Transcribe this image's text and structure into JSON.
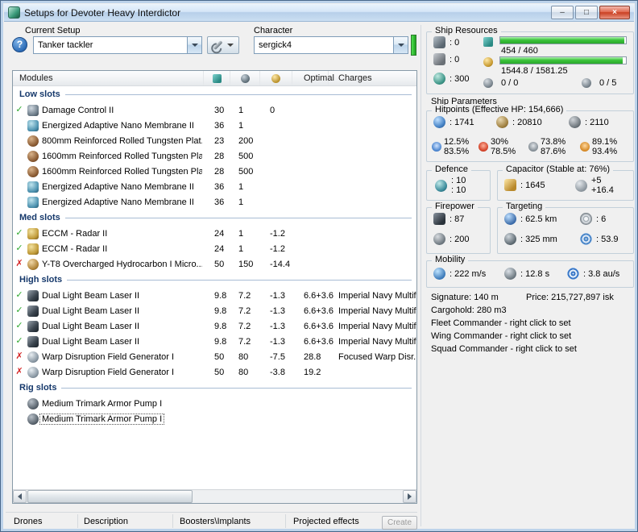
{
  "window": {
    "title": "Setups for Devoter Heavy Interdictor",
    "controls": {
      "minimize": "–",
      "maximize": "□",
      "close": "×"
    }
  },
  "status_glyphs": {
    "ok": "✓",
    "error": "✗"
  },
  "toolbar": {
    "help_label": "?",
    "current_setup_label": "Current Setup",
    "current_setup_value": "Tanker tackler",
    "character_label": "Character",
    "character_value": "sergick4"
  },
  "ship_resources": {
    "title": "Ship Resources",
    "turret_hardpoints": ": 0",
    "launcher_hardpoints": ": 0",
    "calibration": ": 300",
    "cpu": {
      "text": "454 / 460",
      "pct": 98.7
    },
    "powergrid": {
      "text": "1544.8 / 1581.25",
      "pct": 97.7
    },
    "drones": {
      "left": "0 / 0",
      "right": "0 / 5"
    }
  },
  "table": {
    "columns": {
      "modules": "Modules",
      "optimal": "Optimal",
      "charges": "Charges"
    },
    "sections": [
      {
        "name": "Low slots",
        "rows": [
          {
            "status": "ok",
            "icon": "damage-control",
            "name": "Damage Control II",
            "cpu": "30",
            "pg": "1",
            "cap": "0",
            "optimal": "",
            "charges": ""
          },
          {
            "status": "",
            "icon": "membrane",
            "name": "Energized Adaptive Nano Membrane II",
            "cpu": "36",
            "pg": "1",
            "cap": "",
            "optimal": "",
            "charges": ""
          },
          {
            "status": "",
            "icon": "plate",
            "name": "800mm Reinforced Rolled Tungsten Plat...",
            "cpu": "23",
            "pg": "200",
            "cap": "",
            "optimal": "",
            "charges": ""
          },
          {
            "status": "",
            "icon": "plate",
            "name": "1600mm Reinforced Rolled Tungsten Pla...",
            "cpu": "28",
            "pg": "500",
            "cap": "",
            "optimal": "",
            "charges": ""
          },
          {
            "status": "",
            "icon": "plate",
            "name": "1600mm Reinforced Rolled Tungsten Pla...",
            "cpu": "28",
            "pg": "500",
            "cap": "",
            "optimal": "",
            "charges": ""
          },
          {
            "status": "",
            "icon": "membrane",
            "name": "Energized Adaptive Nano Membrane II",
            "cpu": "36",
            "pg": "1",
            "cap": "",
            "optimal": "",
            "charges": ""
          },
          {
            "status": "",
            "icon": "membrane",
            "name": "Energized Adaptive Nano Membrane II",
            "cpu": "36",
            "pg": "1",
            "cap": "",
            "optimal": "",
            "charges": ""
          }
        ]
      },
      {
        "name": "Med slots",
        "rows": [
          {
            "status": "ok",
            "icon": "eccm",
            "name": "ECCM - Radar II",
            "cpu": "24",
            "pg": "1",
            "cap": "-1.2",
            "optimal": "",
            "charges": ""
          },
          {
            "status": "ok",
            "icon": "eccm",
            "name": "ECCM - Radar II",
            "cpu": "24",
            "pg": "1",
            "cap": "-1.2",
            "optimal": "",
            "charges": ""
          },
          {
            "status": "error",
            "icon": "mwd",
            "name": "Y-T8 Overcharged Hydrocarbon I Micro...",
            "cpu": "50",
            "pg": "150",
            "cap": "-14.4",
            "optimal": "",
            "charges": ""
          }
        ]
      },
      {
        "name": "High slots",
        "rows": [
          {
            "status": "ok",
            "icon": "laser",
            "name": "Dual Light Beam Laser II",
            "cpu": "9.8",
            "pg": "7.2",
            "cap": "-1.3",
            "optimal": "6.6+3.6",
            "charges": "Imperial Navy Multif..."
          },
          {
            "status": "ok",
            "icon": "laser",
            "name": "Dual Light Beam Laser II",
            "cpu": "9.8",
            "pg": "7.2",
            "cap": "-1.3",
            "optimal": "6.6+3.6",
            "charges": "Imperial Navy Multif..."
          },
          {
            "status": "ok",
            "icon": "laser",
            "name": "Dual Light Beam Laser II",
            "cpu": "9.8",
            "pg": "7.2",
            "cap": "-1.3",
            "optimal": "6.6+3.6",
            "charges": "Imperial Navy Multif..."
          },
          {
            "status": "ok",
            "icon": "laser",
            "name": "Dual Light Beam Laser II",
            "cpu": "9.8",
            "pg": "7.2",
            "cap": "-1.3",
            "optimal": "6.6+3.6",
            "charges": "Imperial Navy Multif..."
          },
          {
            "status": "error",
            "icon": "fieldgen",
            "name": "Warp Disruption Field Generator I",
            "cpu": "50",
            "pg": "80",
            "cap": "-7.5",
            "optimal": "28.8",
            "charges": "Focused Warp Disr..."
          },
          {
            "status": "error",
            "icon": "fieldgen",
            "name": "Warp Disruption Field Generator I",
            "cpu": "50",
            "pg": "80",
            "cap": "-3.8",
            "optimal": "19.2",
            "charges": ""
          }
        ]
      },
      {
        "name": "Rig slots",
        "rows": [
          {
            "status": "",
            "icon": "rig",
            "name": "Medium Trimark Armor Pump I",
            "cpu": "",
            "pg": "",
            "cap": "",
            "optimal": "",
            "charges": ""
          },
          {
            "status": "",
            "icon": "rig",
            "name": "Medium Trimark Armor Pump I",
            "cpu": "",
            "pg": "",
            "cap": "",
            "optimal": "",
            "charges": "",
            "selected": true
          }
        ]
      }
    ]
  },
  "ship_parameters": {
    "title": "Ship Parameters",
    "hitpoints": {
      "title": "Hitpoints (Effective HP: 154,666)",
      "shield": ": 1741",
      "armor": ": 20810",
      "structure": ": 2110",
      "resists": [
        {
          "top": "12.5%",
          "bottom": "83.5%"
        },
        {
          "top": "30%",
          "bottom": "78.5%"
        },
        {
          "top": "73.8%",
          "bottom": "87.6%"
        },
        {
          "top": "89.1%",
          "bottom": "93.4%"
        }
      ]
    },
    "defence": {
      "title": "Defence",
      "value1": ": 10",
      "value2": ": 10"
    },
    "capacitor": {
      "title": "Capacitor (Stable at: 76%)",
      "amount": ": 1645",
      "delta_top": "+5",
      "delta_bottom": "+16.4"
    },
    "firepower": {
      "title": "Firepower",
      "dps": ": 87",
      "volley": ": 200"
    },
    "targeting": {
      "title": "Targeting",
      "range": ": 62.5 km",
      "max_targets": ": 6",
      "scan_resolution": ": 325 mm",
      "sensor_strength": ": 53.9"
    },
    "mobility": {
      "title": "Mobility",
      "speed": ": 222 m/s",
      "align_time": ": 12.8 s",
      "warp_speed": ": 3.8 au/s"
    },
    "signature": "Signature: 140 m",
    "price": "Price: 215,727,897 isk",
    "cargohold": "Cargohold: 280 m3",
    "fleet_commander": "Fleet Commander - right click to set",
    "wing_commander": "Wing Commander - right click to set",
    "squad_commander": "Squad Commander - right click to set"
  },
  "bottom": {
    "tabs": [
      "Drones",
      "Description",
      "Boosters\\Implants",
      "Projected effects"
    ],
    "create_label": "Create"
  }
}
